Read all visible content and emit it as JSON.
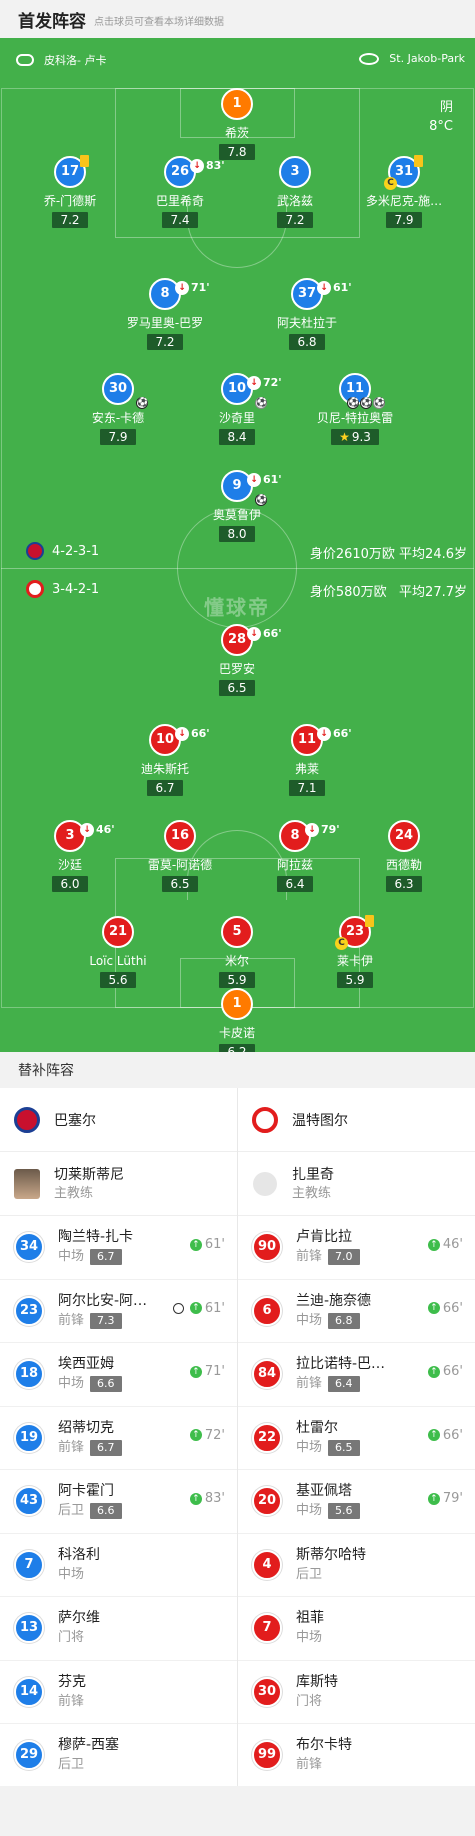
{
  "header": {
    "title": "首发阵容",
    "subtitle": "点击球员可查看本场详细数据"
  },
  "pitch": {
    "referee": "皮科洛- 卢卡",
    "stadium": "St. Jakob-Park",
    "weather": "阴",
    "temperature": "8°C",
    "watermark": "懂球帝",
    "home": {
      "formation": "4-2-3-1",
      "value": "身价2610万欧",
      "avg_age": "平均24.6岁"
    },
    "away": {
      "formation": "3-4-2-1",
      "value": "身价580万欧",
      "avg_age": "平均27.7岁"
    }
  },
  "colors": {
    "pitch": "#43b04a",
    "home": "#1e7ee8",
    "away": "#e21d1d",
    "gk": "#ff7a00",
    "rating_bg": "#1e5c2a",
    "yellow": "#f9c41a"
  },
  "home_lineup": [
    {
      "num": "1",
      "name": "希茨",
      "rating": "7.8",
      "kit": "gk"
    },
    {
      "num": "17",
      "name": "乔-门德斯",
      "rating": "7.2",
      "kit": "blue",
      "yellow": true
    },
    {
      "num": "26",
      "name": "巴里希奇",
      "rating": "7.4",
      "kit": "blue",
      "sub_off": "83'"
    },
    {
      "num": "3",
      "name": "武洛兹",
      "rating": "7.2",
      "kit": "blue"
    },
    {
      "num": "31",
      "name": "多米尼克-施…",
      "rating": "7.9",
      "kit": "blue",
      "yellow": true,
      "captain": true
    },
    {
      "num": "8",
      "name": "罗马里奥-巴罗",
      "rating": "7.2",
      "kit": "blue",
      "sub_off": "71'"
    },
    {
      "num": "37",
      "name": "阿夫杜拉于",
      "rating": "6.8",
      "kit": "blue",
      "sub_off": "61'"
    },
    {
      "num": "30",
      "name": "安东-卡德",
      "rating": "7.9",
      "kit": "blue",
      "goals": 1
    },
    {
      "num": "10",
      "name": "沙奇里",
      "rating": "8.4",
      "kit": "blue",
      "sub_off": "72'",
      "assists": 1
    },
    {
      "num": "11",
      "name": "贝尼-特拉奥雷",
      "rating": "9.3",
      "kit": "blue",
      "goals": 2,
      "assists": 1,
      "best": true
    },
    {
      "num": "9",
      "name": "奥莫鲁伊",
      "rating": "8.0",
      "kit": "blue",
      "sub_off": "61'",
      "goals": 1
    }
  ],
  "away_lineup": [
    {
      "num": "28",
      "name": "巴罗安",
      "rating": "6.5",
      "kit": "red",
      "sub_off": "66'"
    },
    {
      "num": "10",
      "name": "迪朱斯托",
      "rating": "6.7",
      "kit": "red",
      "sub_off": "66'"
    },
    {
      "num": "11",
      "name": "弗莱",
      "rating": "7.1",
      "kit": "red",
      "sub_off": "66'"
    },
    {
      "num": "3",
      "name": "沙廷",
      "rating": "6.0",
      "kit": "red",
      "sub_off": "46'"
    },
    {
      "num": "16",
      "name": "雷莫-阿诺德",
      "rating": "6.5",
      "kit": "red"
    },
    {
      "num": "8",
      "name": "阿拉兹",
      "rating": "6.4",
      "kit": "red",
      "sub_off": "79'"
    },
    {
      "num": "24",
      "name": "西德勒",
      "rating": "6.3",
      "kit": "red"
    },
    {
      "num": "21",
      "name": "Loïc Lüthi",
      "rating": "5.6",
      "kit": "red"
    },
    {
      "num": "5",
      "name": "米尔",
      "rating": "5.9",
      "kit": "red"
    },
    {
      "num": "23",
      "name": "莱卡伊",
      "rating": "5.9",
      "kit": "red",
      "yellow": true,
      "captain": true
    },
    {
      "num": "1",
      "name": "卡皮诺",
      "rating": "6.2",
      "kit": "gk"
    }
  ],
  "bench": {
    "title": "替补阵容",
    "home": {
      "team": "巴塞尔",
      "coach": {
        "name": "切莱斯蒂尼",
        "role": "主教练"
      },
      "players": [
        {
          "num": "34",
          "name": "陶兰特-扎卡",
          "pos": "中场",
          "rating": "6.7",
          "sub_on": "61'"
        },
        {
          "num": "23",
          "name": "阿尔比安-阿…",
          "pos": "前锋",
          "rating": "7.3",
          "sub_on": "61'",
          "goal": true
        },
        {
          "num": "18",
          "name": "埃西亚姆",
          "pos": "中场",
          "rating": "6.6",
          "sub_on": "71'"
        },
        {
          "num": "19",
          "name": "绍蒂切克",
          "pos": "前锋",
          "rating": "6.7",
          "sub_on": "72'"
        },
        {
          "num": "43",
          "name": "阿卡霍门",
          "pos": "后卫",
          "rating": "6.6",
          "sub_on": "83'"
        },
        {
          "num": "7",
          "name": "科洛利",
          "pos": "中场"
        },
        {
          "num": "13",
          "name": "萨尔维",
          "pos": "门将"
        },
        {
          "num": "14",
          "name": "芬克",
          "pos": "前锋"
        },
        {
          "num": "29",
          "name": "穆萨-西塞",
          "pos": "后卫"
        }
      ]
    },
    "away": {
      "team": "温特图尔",
      "coach": {
        "name": "扎里奇",
        "role": "主教练"
      },
      "players": [
        {
          "num": "90",
          "name": "卢肯比拉",
          "pos": "前锋",
          "rating": "7.0",
          "sub_on": "46'"
        },
        {
          "num": "6",
          "name": "兰迪-施奈德",
          "pos": "中场",
          "rating": "6.8",
          "sub_on": "66'"
        },
        {
          "num": "84",
          "name": "拉比诺特-巴…",
          "pos": "前锋",
          "rating": "6.4",
          "sub_on": "66'"
        },
        {
          "num": "22",
          "name": "杜雷尔",
          "pos": "中场",
          "rating": "6.5",
          "sub_on": "66'"
        },
        {
          "num": "20",
          "name": "基亚佩塔",
          "pos": "中场",
          "rating": "5.6",
          "sub_on": "79'"
        },
        {
          "num": "4",
          "name": "斯蒂尔哈特",
          "pos": "后卫"
        },
        {
          "num": "7",
          "name": "祖菲",
          "pos": "中场"
        },
        {
          "num": "30",
          "name": "库斯特",
          "pos": "门将"
        },
        {
          "num": "99",
          "name": "布尔卡特",
          "pos": "前锋"
        }
      ]
    }
  }
}
